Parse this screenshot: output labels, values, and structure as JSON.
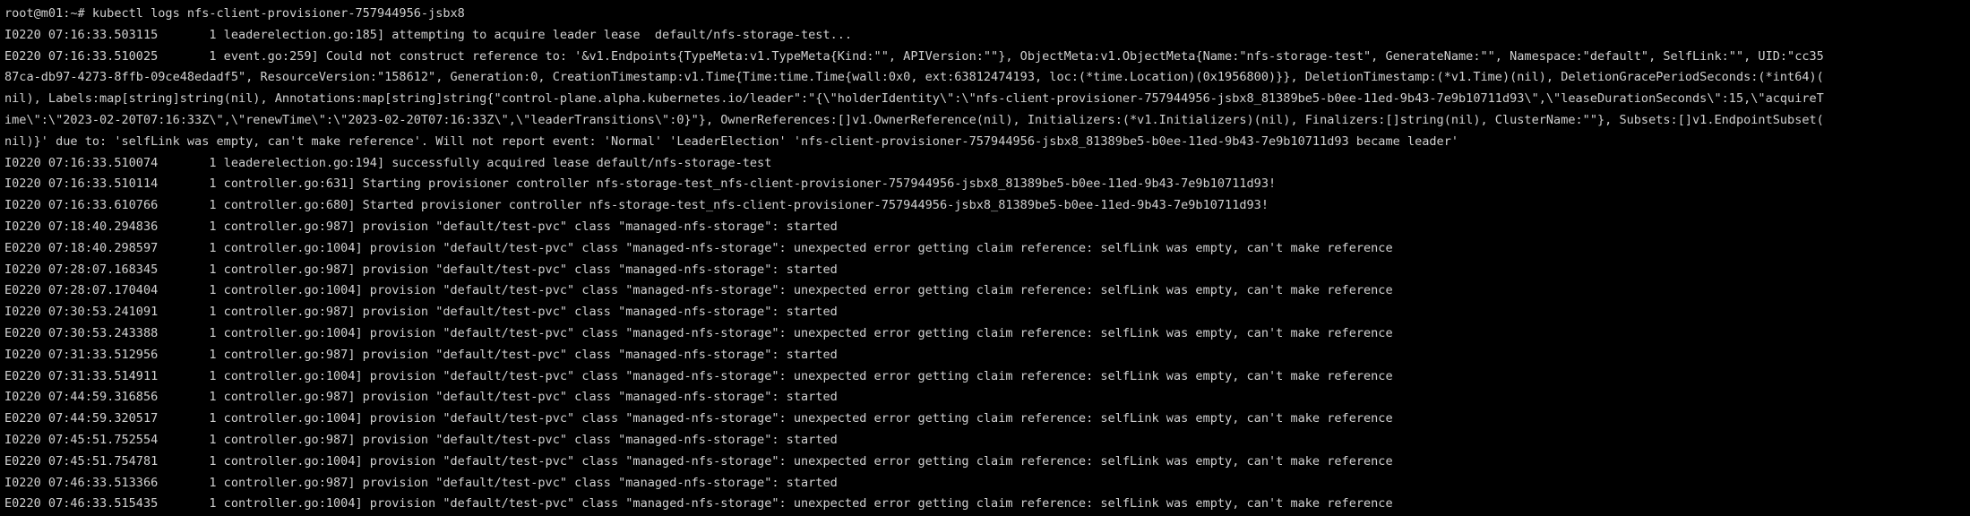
{
  "terminal": {
    "lines": [
      "root@m01:~# kubectl logs nfs-client-provisioner-757944956-jsbx8",
      "I0220 07:16:33.503115       1 leaderelection.go:185] attempting to acquire leader lease  default/nfs-storage-test...",
      "E0220 07:16:33.510025       1 event.go:259] Could not construct reference to: '&v1.Endpoints{TypeMeta:v1.TypeMeta{Kind:\"\", APIVersion:\"\"}, ObjectMeta:v1.ObjectMeta{Name:\"nfs-storage-test\", GenerateName:\"\", Namespace:\"default\", SelfLink:\"\", UID:\"cc35",
      "87ca-db97-4273-8ffb-09ce48edadf5\", ResourceVersion:\"158612\", Generation:0, CreationTimestamp:v1.Time{Time:time.Time{wall:0x0, ext:63812474193, loc:(*time.Location)(0x1956800)}}, DeletionTimestamp:(*v1.Time)(nil), DeletionGracePeriodSeconds:(*int64)(",
      "nil), Labels:map[string]string(nil), Annotations:map[string]string{\"control-plane.alpha.kubernetes.io/leader\":\"{\\\"holderIdentity\\\":\\\"nfs-client-provisioner-757944956-jsbx8_81389be5-b0ee-11ed-9b43-7e9b10711d93\\\",\\\"leaseDurationSeconds\\\":15,\\\"acquireT",
      "ime\\\":\\\"2023-02-20T07:16:33Z\\\",\\\"renewTime\\\":\\\"2023-02-20T07:16:33Z\\\",\\\"leaderTransitions\\\":0}\"}, OwnerReferences:[]v1.OwnerReference(nil), Initializers:(*v1.Initializers)(nil), Finalizers:[]string(nil), ClusterName:\"\"}, Subsets:[]v1.EndpointSubset(",
      "nil)}' due to: 'selfLink was empty, can't make reference'. Will not report event: 'Normal' 'LeaderElection' 'nfs-client-provisioner-757944956-jsbx8_81389be5-b0ee-11ed-9b43-7e9b10711d93 became leader'",
      "I0220 07:16:33.510074       1 leaderelection.go:194] successfully acquired lease default/nfs-storage-test",
      "I0220 07:16:33.510114       1 controller.go:631] Starting provisioner controller nfs-storage-test_nfs-client-provisioner-757944956-jsbx8_81389be5-b0ee-11ed-9b43-7e9b10711d93!",
      "I0220 07:16:33.610766       1 controller.go:680] Started provisioner controller nfs-storage-test_nfs-client-provisioner-757944956-jsbx8_81389be5-b0ee-11ed-9b43-7e9b10711d93!",
      "I0220 07:18:40.294836       1 controller.go:987] provision \"default/test-pvc\" class \"managed-nfs-storage\": started",
      "E0220 07:18:40.298597       1 controller.go:1004] provision \"default/test-pvc\" class \"managed-nfs-storage\": unexpected error getting claim reference: selfLink was empty, can't make reference",
      "I0220 07:28:07.168345       1 controller.go:987] provision \"default/test-pvc\" class \"managed-nfs-storage\": started",
      "E0220 07:28:07.170404       1 controller.go:1004] provision \"default/test-pvc\" class \"managed-nfs-storage\": unexpected error getting claim reference: selfLink was empty, can't make reference",
      "I0220 07:30:53.241091       1 controller.go:987] provision \"default/test-pvc\" class \"managed-nfs-storage\": started",
      "E0220 07:30:53.243388       1 controller.go:1004] provision \"default/test-pvc\" class \"managed-nfs-storage\": unexpected error getting claim reference: selfLink was empty, can't make reference",
      "I0220 07:31:33.512956       1 controller.go:987] provision \"default/test-pvc\" class \"managed-nfs-storage\": started",
      "E0220 07:31:33.514911       1 controller.go:1004] provision \"default/test-pvc\" class \"managed-nfs-storage\": unexpected error getting claim reference: selfLink was empty, can't make reference",
      "I0220 07:44:59.316856       1 controller.go:987] provision \"default/test-pvc\" class \"managed-nfs-storage\": started",
      "E0220 07:44:59.320517       1 controller.go:1004] provision \"default/test-pvc\" class \"managed-nfs-storage\": unexpected error getting claim reference: selfLink was empty, can't make reference",
      "I0220 07:45:51.752554       1 controller.go:987] provision \"default/test-pvc\" class \"managed-nfs-storage\": started",
      "E0220 07:45:51.754781       1 controller.go:1004] provision \"default/test-pvc\" class \"managed-nfs-storage\": unexpected error getting claim reference: selfLink was empty, can't make reference",
      "I0220 07:46:33.513366       1 controller.go:987] provision \"default/test-pvc\" class \"managed-nfs-storage\": started",
      "E0220 07:46:33.515435       1 controller.go:1004] provision \"default/test-pvc\" class \"managed-nfs-storage\": unexpected error getting claim reference: selfLink was empty, can't make reference"
    ]
  }
}
